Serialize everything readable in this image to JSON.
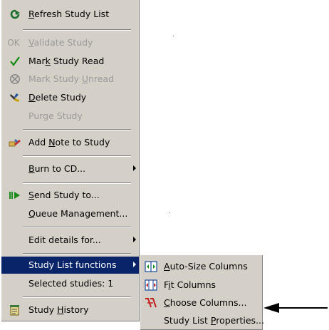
{
  "menu": {
    "items": [
      {
        "label": "Refresh Study List",
        "underline": "R",
        "icon": "refresh-icon"
      },
      {
        "label": "Validate Study",
        "underline": "V",
        "prefix": "OK",
        "disabled": true
      },
      {
        "label": "Mark Study Read",
        "underline": "k",
        "icon": "checkmark-icon"
      },
      {
        "label": "Mark Study Unread",
        "underline": "U",
        "icon": "unread-icon",
        "disabled": true
      },
      {
        "label": "Delete Study",
        "underline": "D",
        "icon": "delete-icon"
      },
      {
        "label": "Purge Study",
        "underline": "g",
        "disabled": true
      },
      {
        "label": "Add Note to Study",
        "underline": "N",
        "icon": "note-icon"
      },
      {
        "label": "Burn to CD...",
        "underline": "B",
        "submenu": true
      },
      {
        "label": "Send Study to...",
        "underline": "S",
        "icon": "send-icon"
      },
      {
        "label": "Queue Management...",
        "underline": "Q"
      },
      {
        "label": "Edit details for...",
        "submenu": true
      },
      {
        "label": "Study List functions",
        "submenu": true,
        "highlighted": true
      },
      {
        "label": "Selected studies: 1"
      },
      {
        "label": "Study History",
        "underline": "H",
        "icon": "history-icon"
      }
    ]
  },
  "submenu": {
    "items": [
      {
        "label": "Auto-Size Columns",
        "underline": "A",
        "icon": "auto-size-columns-icon"
      },
      {
        "label": "Fit Columns",
        "underline": "i",
        "icon": "fit-columns-icon"
      },
      {
        "label": "Choose Columns...",
        "underline": "C",
        "icon": "choose-columns-icon"
      },
      {
        "label": "Study List Properties...",
        "underline": "P"
      }
    ]
  },
  "colors": {
    "menu_bg": "#d4d0c8",
    "highlight": "#0a246a",
    "disabled_text": "#9a9a9a"
  }
}
